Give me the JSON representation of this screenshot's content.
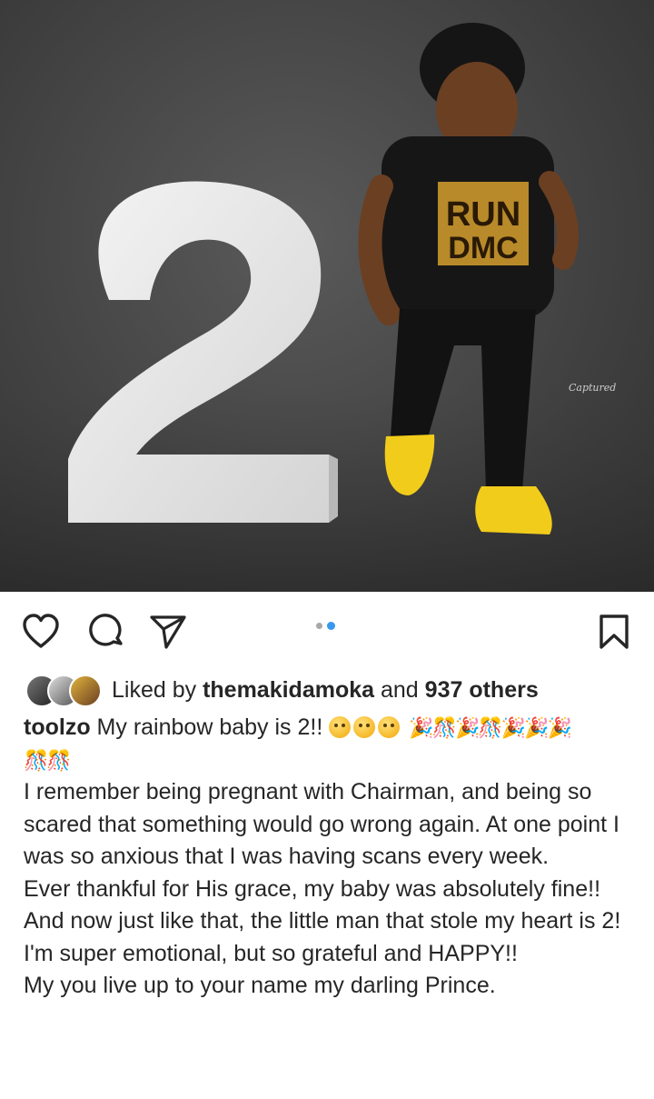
{
  "post": {
    "image": {
      "description_icon": "photo-icon",
      "watermark": "Captured"
    },
    "carousel": {
      "count": 2,
      "active_index": 1
    },
    "actions": {
      "like_icon": "heart-icon",
      "comment_icon": "comment-icon",
      "share_icon": "send-icon",
      "save_icon": "bookmark-icon"
    },
    "likes": {
      "prefix": "Liked by",
      "liker": "themakidamoka",
      "connector": "and",
      "others": "937 others"
    },
    "caption": {
      "username": "toolzo",
      "first_line": "My rainbow baby is 2!!",
      "emoji_faces": "🥹🥹🥹",
      "party_emojis": "🎉🎊🎉🎊🎉🎉🎉",
      "party_emojis_2": "🎊🎊",
      "lines": [
        "I remember being pregnant with Chairman, and being so scared that something would go wrong again. At one point I was so anxious that I was having scans every week.",
        "Ever thankful for His grace, my baby was absolutely fine!!",
        "And now just like that, the little man that stole my heart is 2!",
        "I'm super emotional, but so grateful and HAPPY!!",
        "My you live up to your name my darling Prince."
      ]
    },
    "colors": {
      "accent_blue": "#3897f0",
      "text": "#262626",
      "shoe_yellow": "#f2cc1b"
    }
  }
}
